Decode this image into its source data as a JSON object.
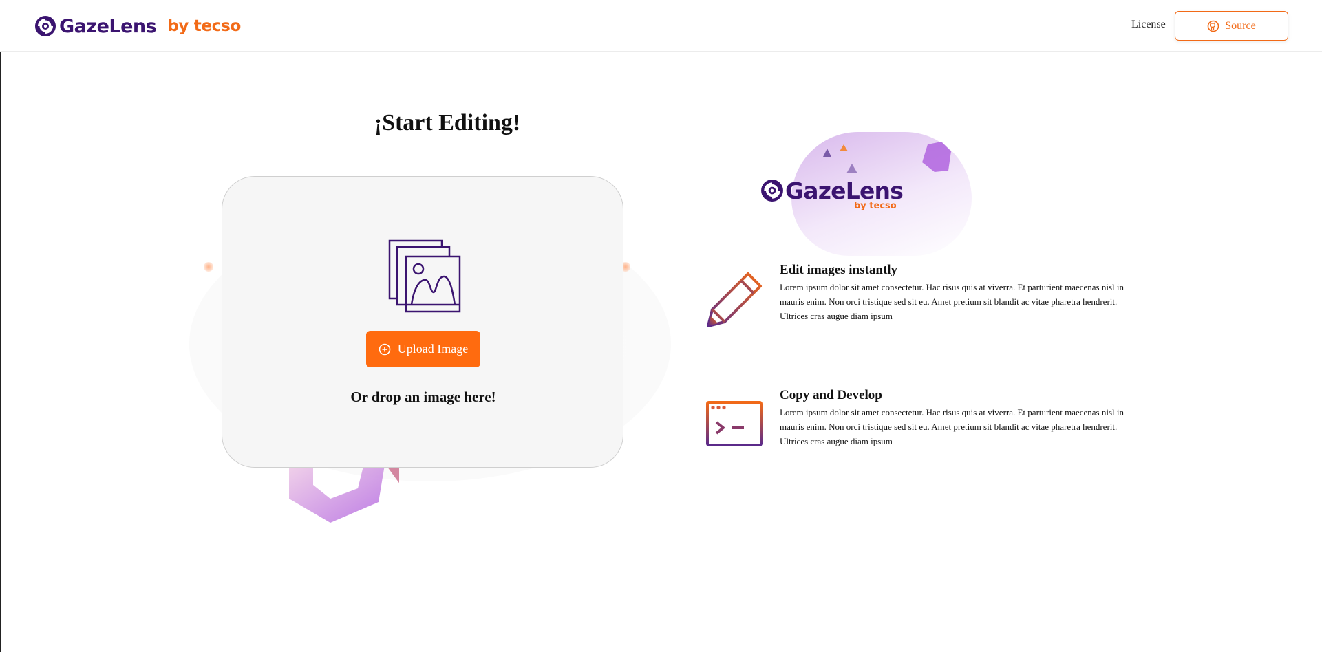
{
  "header": {
    "brand_name": "GazeLens",
    "brand_by": "by tecso",
    "nav_license": "License",
    "source_label": "Source"
  },
  "main": {
    "title": "¡Start Editing!",
    "upload_label": "Upload Image",
    "drop_text": "Or drop an image here!"
  },
  "side": {
    "logo_name": "GazeLens",
    "logo_by": "by tecso",
    "features": [
      {
        "title": "Edit images instantly",
        "text": "Lorem ipsum dolor sit amet consectetur. Hac risus quis at viverra. Et parturient maecenas nisl in mauris enim. Non orci tristique sed sit eu. Amet pretium sit blandit ac vitae pharetra hendrerit. Ultrices cras augue diam ipsum",
        "icon": "pencil-icon"
      },
      {
        "title": "Copy and Develop",
        "text": "Lorem ipsum dolor sit amet consectetur. Hac risus quis at viverra. Et parturient maecenas nisl in mauris enim. Non orci tristique sed sit eu. Amet pretium sit blandit ac vitae pharetra hendrerit. Ultrices cras augue diam ipsum",
        "icon": "terminal-window-icon"
      }
    ]
  },
  "colors": {
    "brand_purple": "#3b1470",
    "accent_orange": "#ff6b0f",
    "card_bg": "#f6f6f6"
  }
}
